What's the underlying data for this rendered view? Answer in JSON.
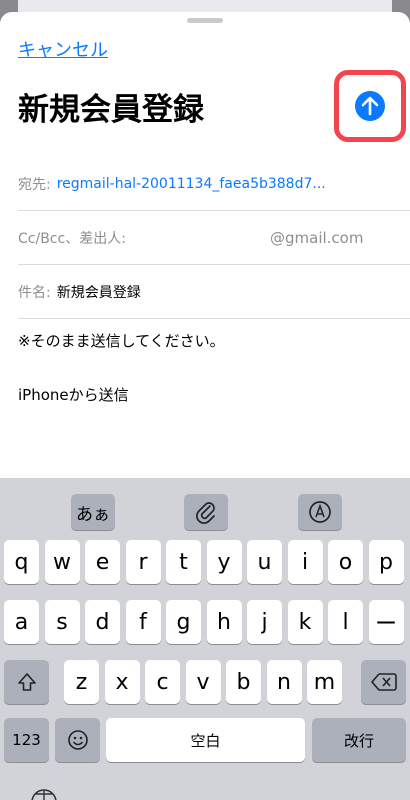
{
  "compose": {
    "cancel_label": "キャンセル",
    "title": "新規会員登録",
    "to_label": "宛先:",
    "to_value": "regmail-hal-20011134_faea5b388d7...",
    "cc_label": "Cc/Bcc、差出人:",
    "cc_value": "@gmail.com",
    "subject_label": "件名:",
    "subject_value": "新規会員登録",
    "body_line1": "※そのまま送信してください。",
    "body_line2": "iPhoneから送信"
  },
  "keyboard": {
    "toolbar": {
      "kana_label": "あぁ"
    },
    "row1": [
      "q",
      "w",
      "e",
      "r",
      "t",
      "y",
      "u",
      "i",
      "o",
      "p"
    ],
    "row2": [
      "a",
      "s",
      "d",
      "f",
      "g",
      "h",
      "j",
      "k",
      "l",
      "ー"
    ],
    "row3": [
      "z",
      "x",
      "c",
      "v",
      "b",
      "n",
      "m"
    ],
    "numbers_label": "123",
    "space_label": "空白",
    "return_label": "改行"
  },
  "colors": {
    "accent": "#0a7aff",
    "highlight": "#f4454f"
  }
}
